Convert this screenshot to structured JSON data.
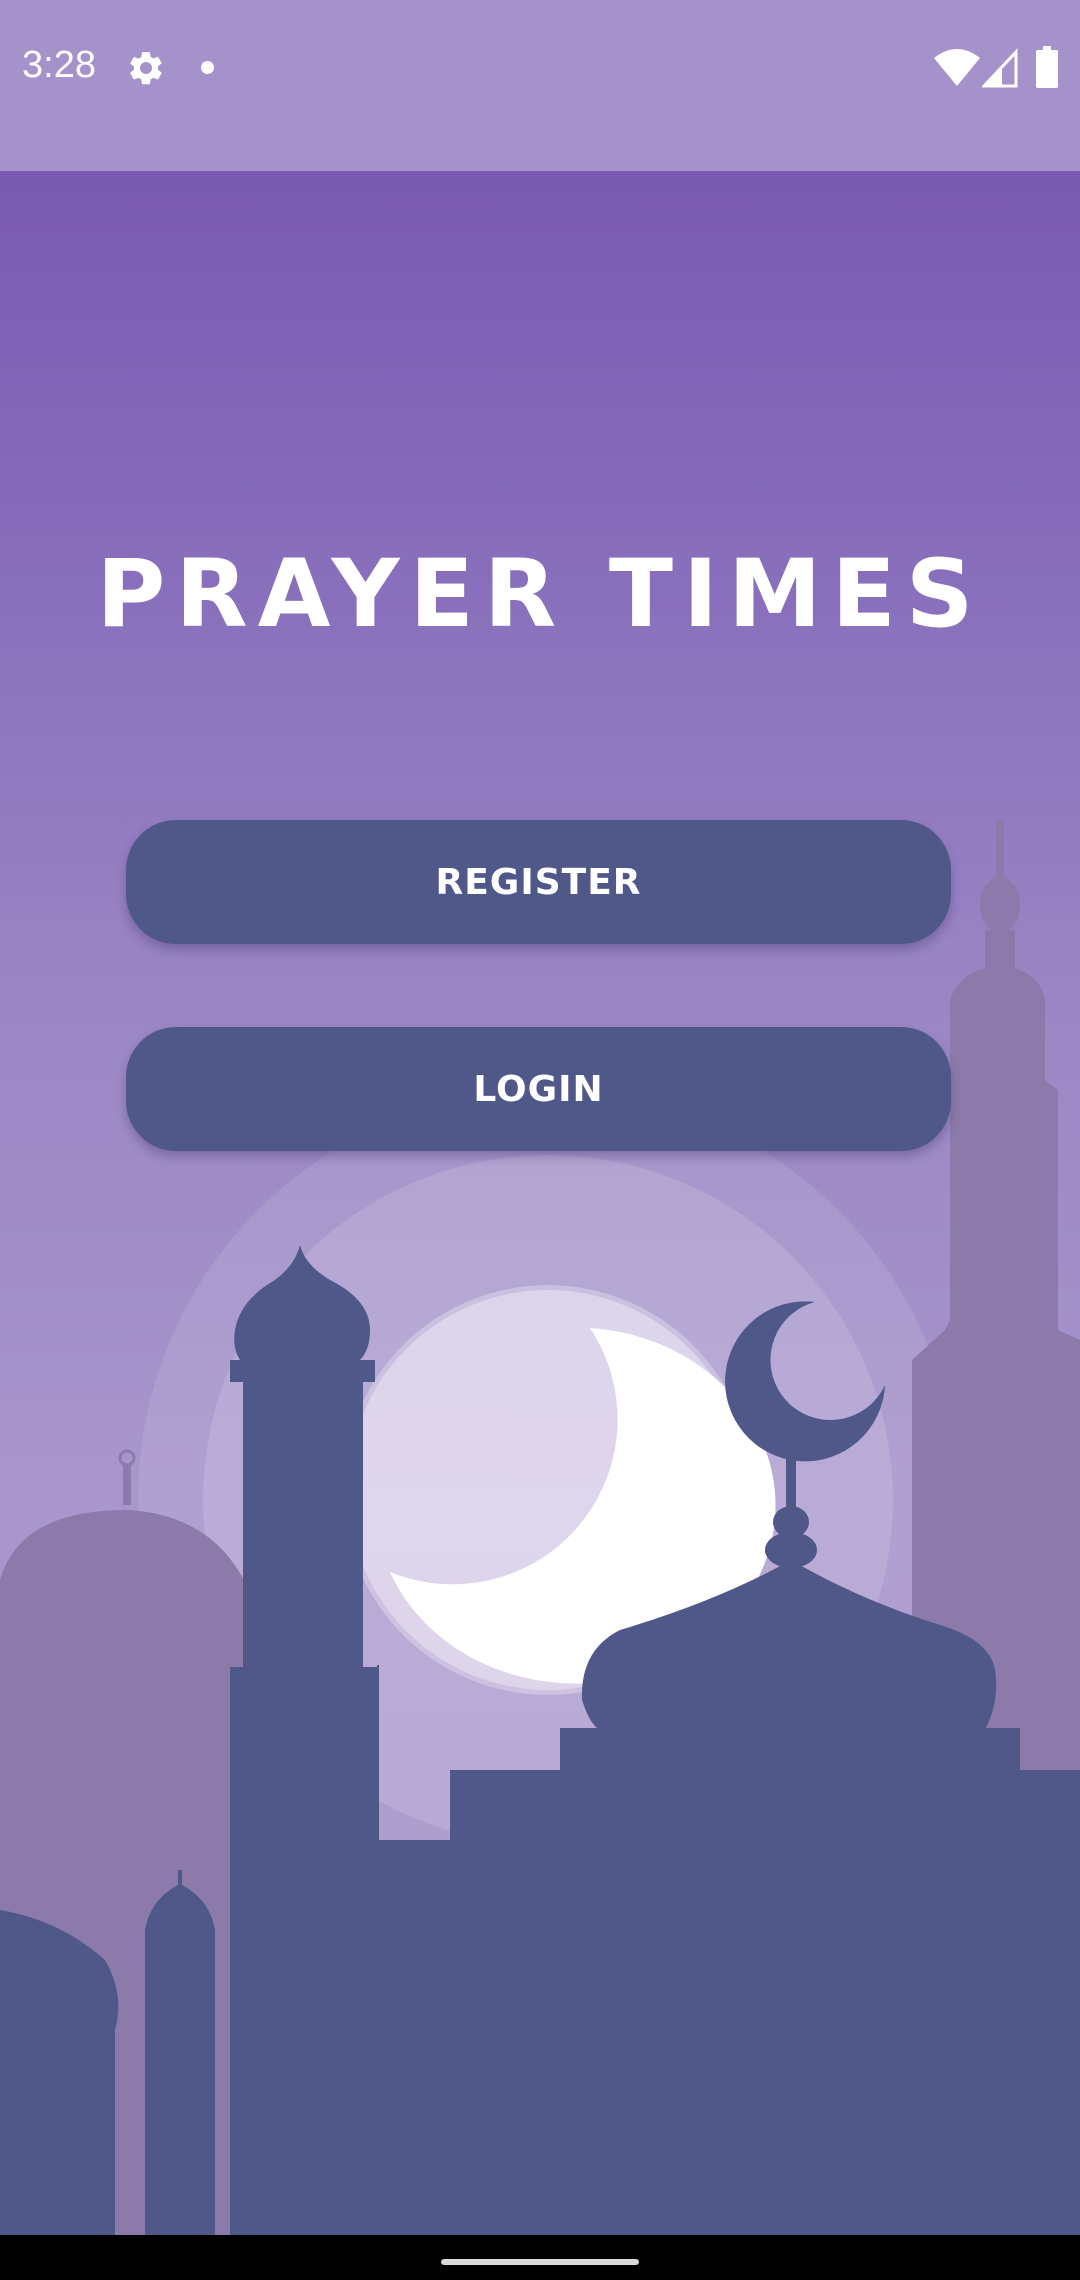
{
  "status_bar": {
    "time": "3:28",
    "icons": [
      "gear-icon",
      "notification-dot-icon",
      "wifi-icon",
      "signal-icon",
      "battery-icon"
    ]
  },
  "app": {
    "title": "PRAYER TIMES"
  },
  "buttons": {
    "register_label": "REGISTER",
    "login_label": "LOGIN"
  },
  "colors": {
    "header_purple": "#7452ad",
    "button_fill": "#50588a",
    "mosque_silhouette": "#50588a",
    "background_minarets": "#8c7aaa",
    "moon": "#ffffff"
  }
}
